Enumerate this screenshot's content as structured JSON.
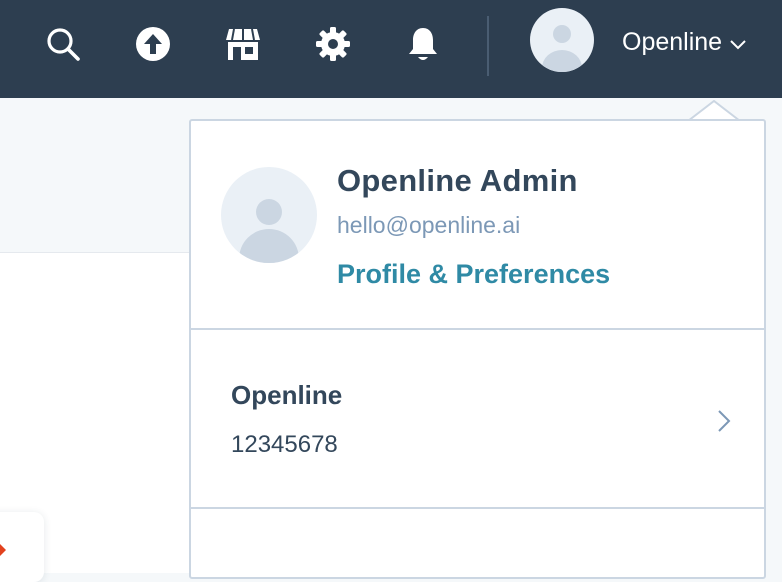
{
  "topbar": {
    "icons": [
      "search-icon",
      "upload-icon",
      "marketplace-icon",
      "settings-icon",
      "notifications-icon"
    ],
    "account_name": "Openline",
    "dropdown_icon": "chevron-down-icon"
  },
  "profile": {
    "name": "Openline Admin",
    "email": "hello@openline.ai",
    "link_label": "Profile & Preferences"
  },
  "account": {
    "name": "Openline",
    "id": "12345678",
    "chevron_icon": "chevron-right-icon"
  },
  "colors": {
    "topbar": "#2d3e50",
    "link": "#2f8aa5",
    "text": "#33475b",
    "muted": "#7c98b6",
    "border": "#cbd6e2"
  }
}
